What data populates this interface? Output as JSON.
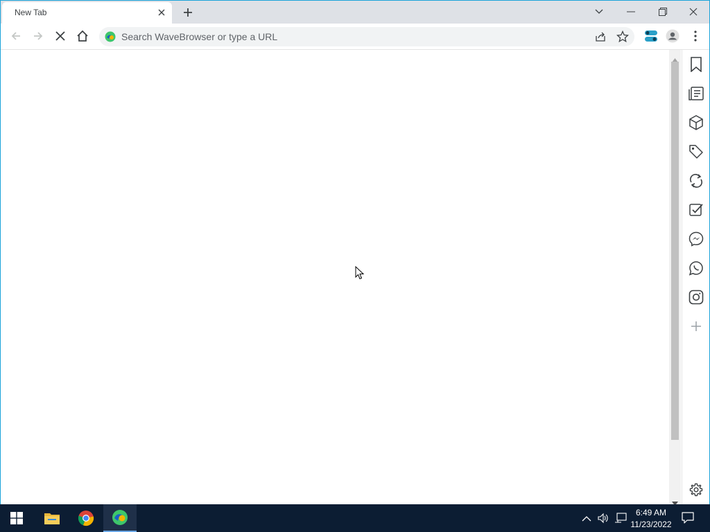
{
  "browser": {
    "tab": {
      "title": "New Tab"
    },
    "omnibox": {
      "placeholder": "Search WaveBrowser or type a URL"
    }
  },
  "sidebar": {
    "icons": [
      "bookmark-icon",
      "reading-list-icon",
      "package-icon",
      "tag-icon",
      "sync-icon",
      "checklist-icon",
      "messenger-icon",
      "whatsapp-icon",
      "instagram-icon",
      "add-icon"
    ],
    "settings_icon": "gear-icon"
  },
  "taskbar": {
    "apps": [
      "windows-start",
      "file-explorer",
      "chrome",
      "wavebrowser"
    ],
    "clock": {
      "time": "6:49 AM",
      "date": "11/23/2022"
    }
  },
  "colors": {
    "window_border": "#1aa3d9",
    "taskbar": "#0c1d33",
    "tabstrip": "#dee1e6",
    "omnibox": "#f1f3f4"
  }
}
